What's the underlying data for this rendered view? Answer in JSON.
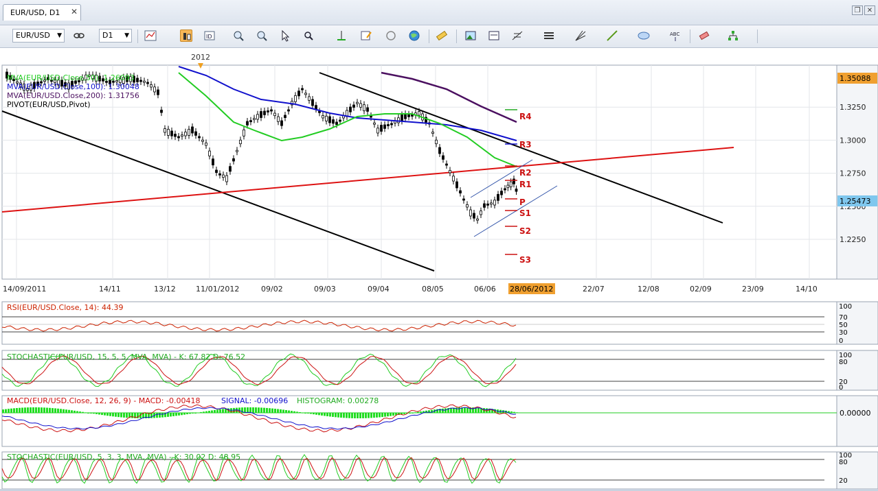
{
  "tab": {
    "title": "EUR/USD, D1",
    "close_glyph": "✕"
  },
  "window_buttons": [
    "restore-icon",
    "close-icon"
  ],
  "toolbar": {
    "symbol": "EUR/USD",
    "period": "D1"
  },
  "chart": {
    "year_marker": "2012",
    "legend": [
      {
        "text": "MVA(EUR/USD.Close,50): 1.26093",
        "color": "#22cc22"
      },
      {
        "text": "MVA(EUR/USD.Close,100): 1.30048",
        "color": "#1010cc"
      },
      {
        "text": "MVA(EUR/USD.Close,200): 1.31756",
        "color": "#4b1060"
      },
      {
        "text": "PIVOT(EUR/USD,Pivot)",
        "color": "#000000"
      }
    ],
    "price_ticks": [
      "1.3250",
      "1.3000",
      "1.2750",
      "1.2500",
      "1.2250"
    ],
    "top_price": "1.35088",
    "current_price": "1.25473",
    "pivot_levels": [
      "R4",
      "R3",
      "R2",
      "R1",
      "P",
      "S1",
      "S2",
      "S3"
    ],
    "date_ticks": [
      "14/09/2011",
      "14/11",
      "13/12",
      "11/01/2012",
      "09/02",
      "09/03",
      "09/04",
      "08/05",
      "06/06",
      "22/07",
      "12/08",
      "02/09",
      "23/09",
      "14/10"
    ],
    "cursor_date": "28/06/2012"
  },
  "rsi": {
    "label": "RSI(EUR/USD.Close, 14): 44.39",
    "color": "#cc2200",
    "ticks": [
      "100",
      "70",
      "50",
      "30",
      "0"
    ]
  },
  "stoch1": {
    "label": "STOCHASTIC(EUR/USD, 15, 5, 5, MVA, MVA) -  K: 67.82  D: 76.52",
    "ticks": [
      "100",
      "80",
      "20",
      "0"
    ]
  },
  "macd": {
    "label_main": "MACD(EUR/USD.Close, 12, 26, 9) -  MACD: -0.00418",
    "label_signal": "SIGNAL: -0.00696",
    "label_hist": "HISTOGRAM: 0.00278",
    "tick": "0.00000"
  },
  "stoch2": {
    "label": "STOCHASTIC(EUR/USD, 5, 3, 3, MVA, MVA) -  K: 30.02  D: 48.95",
    "ticks": [
      "100",
      "80",
      "20"
    ]
  }
}
